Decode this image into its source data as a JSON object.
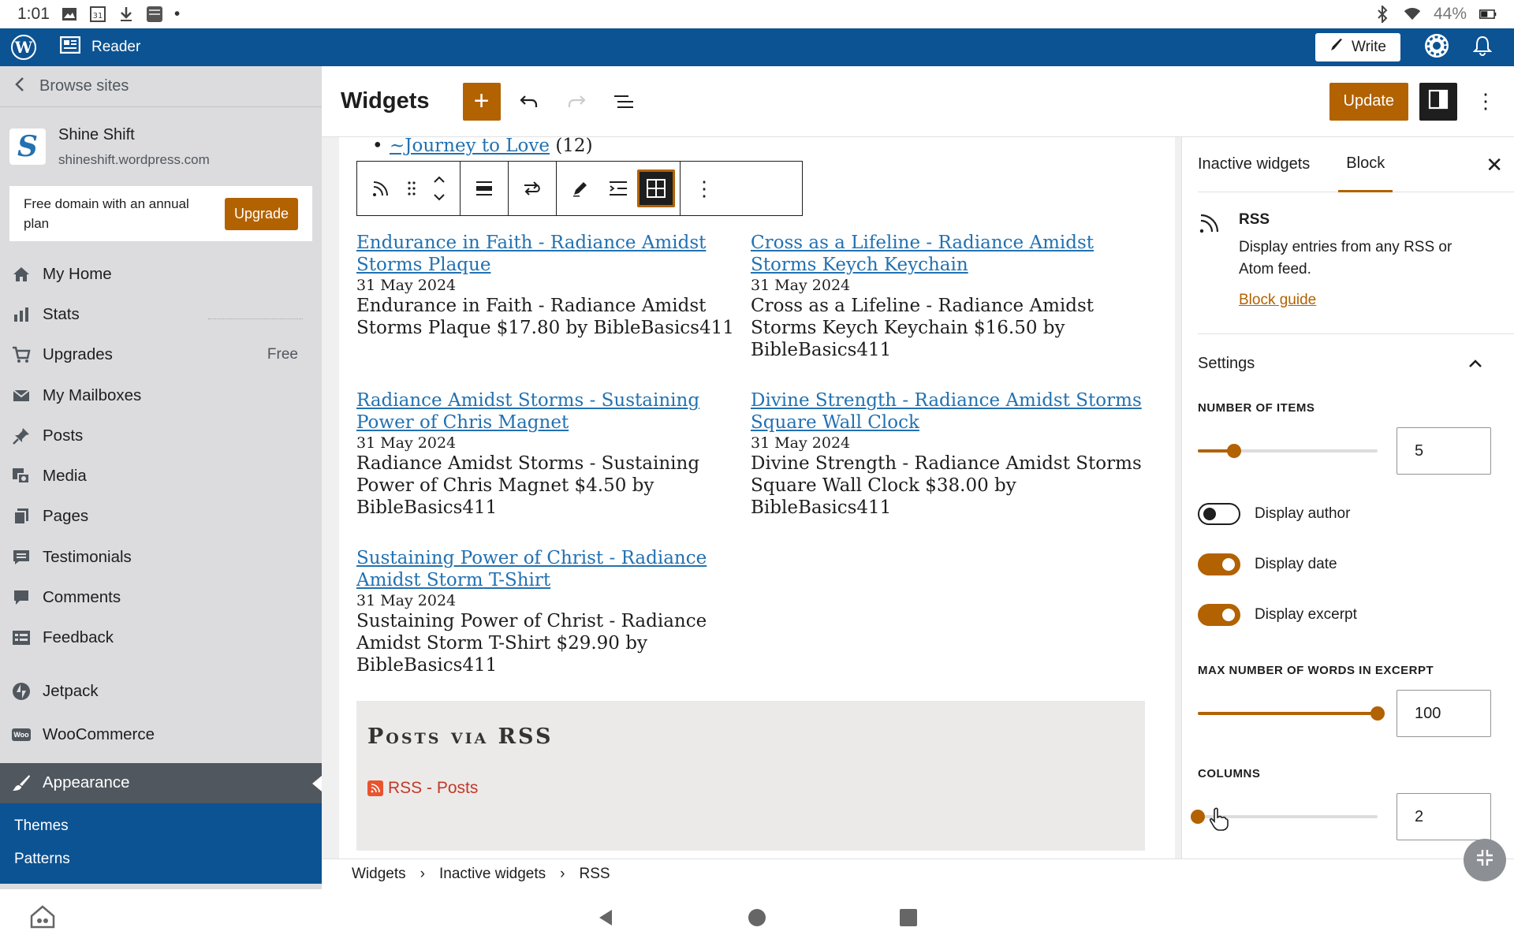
{
  "status_bar": {
    "time": "1:01",
    "calendar_day": "31",
    "battery": "44%"
  },
  "topbar": {
    "reader_label": "Reader",
    "write_label": "Write"
  },
  "sidebar": {
    "browse_label": "Browse sites",
    "site_name": "Shine Shift",
    "site_url": "shineshift.wordpress.com",
    "site_initial": "S",
    "promo_text": "Free domain with an annual plan",
    "promo_button": "Upgrade",
    "items": [
      {
        "label": "My Home",
        "icon": "home-icon"
      },
      {
        "label": "Stats",
        "icon": "stats-icon"
      },
      {
        "label": "Upgrades",
        "icon": "cart-icon",
        "badge": "Free"
      },
      {
        "label": "My Mailboxes",
        "icon": "mail-icon"
      },
      {
        "label": "Posts",
        "icon": "pin-icon"
      },
      {
        "label": "Media",
        "icon": "media-icon"
      },
      {
        "label": "Pages",
        "icon": "pages-icon"
      },
      {
        "label": "Testimonials",
        "icon": "testimonial-icon"
      },
      {
        "label": "Comments",
        "icon": "comment-icon"
      },
      {
        "label": "Feedback",
        "icon": "feedback-icon"
      },
      {
        "label": "Jetpack",
        "icon": "jetpack-icon"
      },
      {
        "label": "WooCommerce",
        "icon": "woo-icon",
        "icon_text": "Woo"
      },
      {
        "label": "Appearance",
        "icon": "brush-icon"
      }
    ],
    "sub_items": [
      "Themes",
      "Patterns"
    ]
  },
  "editor": {
    "title": "Widgets",
    "update_label": "Update",
    "journey_link": "~Journey to Love",
    "journey_count": "(12)",
    "rss_items": [
      {
        "title": "Endurance in Faith - Radiance Amidst Storms Plaque",
        "date": "31 May 2024",
        "excerpt": "Endurance in Faith - Radiance Amidst Storms Plaque $17.80 by BibleBasics411"
      },
      {
        "title": "Cross as a Lifeline - Radiance Amidst Storms Keych Keychain",
        "date": "31 May 2024",
        "excerpt": "Cross as a Lifeline - Radiance Amidst Storms Keych Keychain $16.50 by BibleBasics411"
      },
      {
        "title": "Radiance Amidst Storms - Sustaining Power of Chris Magnet",
        "date": "31 May 2024",
        "excerpt": "Radiance Amidst Storms - Sustaining Power of Chris Magnet $4.50 by BibleBasics411"
      },
      {
        "title": "Divine Strength - Radiance Amidst Storms Square Wall Clock",
        "date": "31 May 2024",
        "excerpt": "Divine Strength - Radiance Amidst Storms Square Wall Clock $38.00 by BibleBasics411"
      },
      {
        "title": "Sustaining Power of Christ - Radiance Amidst Storm T-Shirt",
        "date": "31 May 2024",
        "excerpt": "Sustaining Power of Christ - Radiance Amidst Storm T-Shirt $29.90 by BibleBasics411"
      }
    ],
    "footer_widget_title": "Posts via RSS",
    "footer_widget_link": "RSS - Posts"
  },
  "inspector": {
    "tabs": [
      "Inactive widgets",
      "Block"
    ],
    "block_name": "RSS",
    "block_desc": "Display entries from any RSS or Atom feed.",
    "block_guide": "Block guide",
    "settings_label": "Settings",
    "items_label": "NUMBER OF ITEMS",
    "items_value": "5",
    "items_fraction": 0.2,
    "display_author": "Display author",
    "display_date": "Display date",
    "display_excerpt": "Display excerpt",
    "author_on": false,
    "date_on": true,
    "excerpt_on": true,
    "max_words_label": "MAX NUMBER OF WORDS IN EXCERPT",
    "max_words_value": "100",
    "max_words_fraction": 1.0,
    "columns_label": "COLUMNS",
    "columns_value": "2",
    "columns_fraction": 0.0
  },
  "breadcrumb": [
    "Widgets",
    "Inactive widgets",
    "RSS"
  ],
  "colors": {
    "accent": "#b26200",
    "brand": "#0c5393",
    "link": "#2271b1"
  }
}
